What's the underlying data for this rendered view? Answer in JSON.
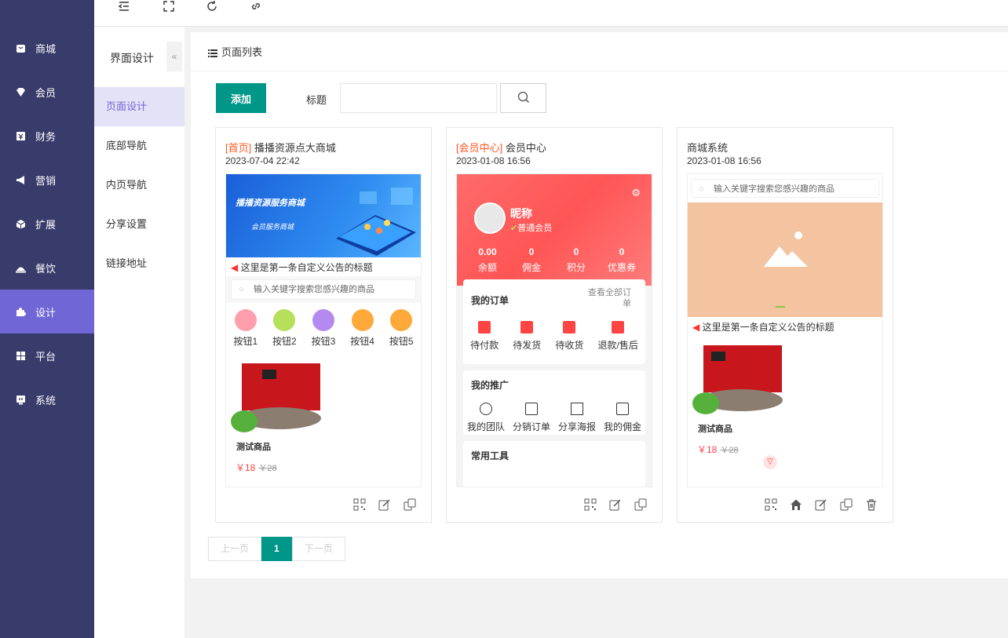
{
  "sidebar": {
    "items": [
      {
        "label": "商城",
        "icon": "shop-icon"
      },
      {
        "label": "会员",
        "icon": "member-icon"
      },
      {
        "label": "财务",
        "icon": "finance-icon"
      },
      {
        "label": "营销",
        "icon": "megaphone-icon"
      },
      {
        "label": "扩展",
        "icon": "cube-icon"
      },
      {
        "label": "餐饮",
        "icon": "dining-icon"
      },
      {
        "label": "设计",
        "icon": "puzzle-icon",
        "active": true
      },
      {
        "label": "平台",
        "icon": "grid-icon"
      },
      {
        "label": "系统",
        "icon": "system-icon"
      }
    ]
  },
  "subnav": {
    "title": "界面设计",
    "collapse": "«",
    "items": [
      "页面设计",
      "底部导航",
      "内页导航",
      "分享设置",
      "链接地址"
    ],
    "active": 0
  },
  "main": {
    "header": "页面列表",
    "add_label": "添加",
    "title_label": "标题",
    "search_placeholder": "",
    "pager": {
      "prev": "上一页",
      "current": "1",
      "next": "下一页"
    }
  },
  "cards": [
    {
      "tag": "[首页]",
      "name": "播播资源点大商城",
      "date": "2023-07-04 22:42",
      "banner_title": "播播资源服务商城",
      "banner_sub": "会员服务商城",
      "notice": "这里是第一条自定义公告的标题",
      "search": "输入关键字搜索您感兴趣的商品",
      "buttons": [
        "按钮1",
        "按钮2",
        "按钮3",
        "按钮4",
        "按钮5"
      ],
      "goods_name": "测试商品",
      "price": "￥18",
      "old_price": "￥28"
    },
    {
      "tag": "[会员中心]",
      "name": "会员中心",
      "date": "2023-01-08 16:56",
      "nickname": "昵称",
      "level": "普通会员",
      "stats": [
        {
          "v": "0.00",
          "l": "余额"
        },
        {
          "v": "0",
          "l": "佣金"
        },
        {
          "v": "0",
          "l": "积分"
        },
        {
          "v": "0",
          "l": "优惠券"
        }
      ],
      "orders_title": "我的订单",
      "orders_all": "查看全部订单",
      "orders": [
        "待付款",
        "待发货",
        "待收货",
        "退款/售后"
      ],
      "promo_title": "我的推广",
      "promo": [
        "我的团队",
        "分销订单",
        "分享海报",
        "我的佣金"
      ],
      "tools_title": "常用工具"
    },
    {
      "tag": "",
      "name": "商城系统",
      "date": "2023-01-08 16:56",
      "search": "输入关键字搜索您感兴趣的商品",
      "notice": "这里是第一条自定义公告的标题",
      "goods_name": "测试商品",
      "price": "￥18",
      "old_price": "￥28"
    }
  ],
  "colors": {
    "sidebar": "#393b6b",
    "active": "#7066d6",
    "primary": "#009688",
    "tag": "#ff5722"
  }
}
